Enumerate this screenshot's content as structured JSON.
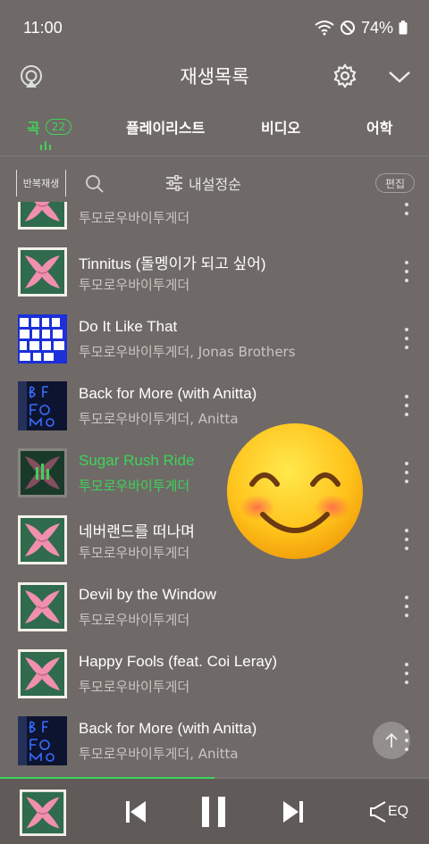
{
  "status": {
    "time": "11:00",
    "battery": "74%"
  },
  "header": {
    "title": "재생목록"
  },
  "tabs": [
    {
      "label": "곡",
      "count": "22",
      "active": true
    },
    {
      "label": "플레이리스트"
    },
    {
      "label": "비디오"
    },
    {
      "label": "어학"
    }
  ],
  "toolbar": {
    "repeat_label": "반복재생",
    "sort_label": "내설정순",
    "edit_label": "편집"
  },
  "songs": [
    {
      "title": "Happy Fools (feat. Coi Leray)",
      "artist": "투모로우바이투게더",
      "cover": "pink-x"
    },
    {
      "title": "Tinnitus (돌멩이가 되고 싶어)",
      "artist": "투모로우바이투게더",
      "cover": "pink-x"
    },
    {
      "title": "Do It Like That",
      "artist": "투모로우바이투게더, Jonas Brothers",
      "cover": "do-it"
    },
    {
      "title": "Back for More (with Anitta)",
      "artist": "투모로우바이투게더, Anitta",
      "cover": "back-for-more"
    },
    {
      "title": "Sugar Rush Ride",
      "artist": "투모로우바이투게더",
      "cover": "pink-x",
      "playing": true
    },
    {
      "title": "네버랜드를 떠나며",
      "artist": "투모로우바이투게더",
      "cover": "pink-x"
    },
    {
      "title": "Devil by the Window",
      "artist": "투모로우바이투게더",
      "cover": "pink-x"
    },
    {
      "title": "Happy Fools (feat. Coi Leray)",
      "artist": "투모로우바이투게더",
      "cover": "pink-x"
    },
    {
      "title": "Back for More (with Anitta)",
      "artist": "투모로우바이투게더, Anitta",
      "cover": "back-for-more"
    }
  ],
  "player": {
    "progress": 0.5,
    "eq_label": "EQ"
  },
  "colors": {
    "accent": "#3dd35a",
    "background": "#6f6a67"
  }
}
